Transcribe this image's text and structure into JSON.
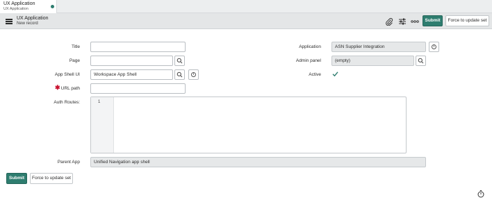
{
  "tab": {
    "title": "UX Application",
    "subtitle": "UX Application"
  },
  "header": {
    "title": "UX Application",
    "subtitle": "New record",
    "icons": [
      "paperclip-icon",
      "sliders-icon",
      "more-icon"
    ],
    "submit_label": "Submit",
    "force_label": "Force to update set"
  },
  "form": {
    "title": {
      "label": "Title",
      "value": ""
    },
    "page": {
      "label": "Page",
      "value": ""
    },
    "app_shell_ui": {
      "label": "App Shell UI",
      "value": "Workspace App Shell"
    },
    "url_path": {
      "label": "URL path",
      "value": "",
      "required": true
    },
    "auth_routes": {
      "label": "Auth Routes:",
      "line_number": "1"
    },
    "application": {
      "label": "Application",
      "value": "ASN Supplier Integration"
    },
    "admin_panel": {
      "label": "Admin panel",
      "value": "(empty)"
    },
    "active": {
      "label": "Active",
      "checked": true
    },
    "parent_app": {
      "label": "Parent App",
      "value": "Unified Navigation app shell"
    }
  },
  "footer": {
    "submit_label": "Submit",
    "force_label": "Force to update set"
  },
  "colors": {
    "accent": "#2e7d6f",
    "required": "#c8102e"
  }
}
